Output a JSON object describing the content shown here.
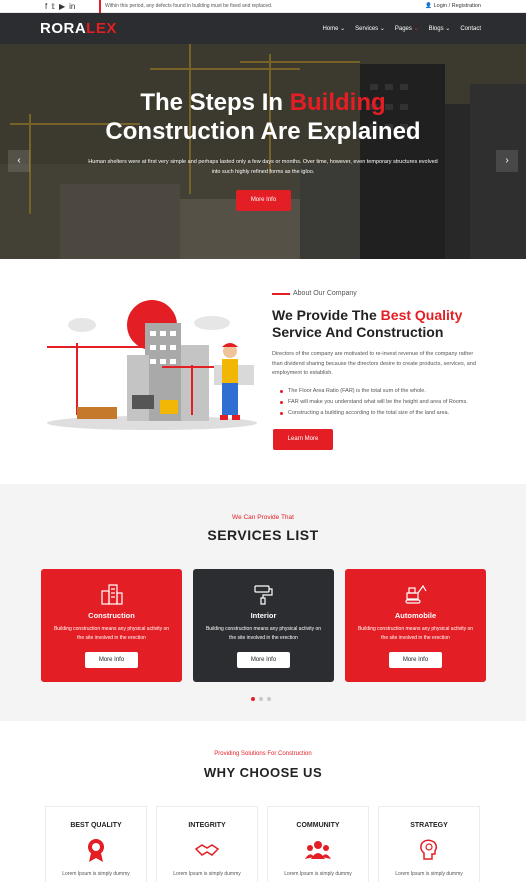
{
  "topbar": {
    "social_icons": [
      "facebook-icon",
      "twitter-icon",
      "youtube-icon",
      "linkedin-icon"
    ],
    "notice": "Within this period, any defects found in building must be fixed and replaced.",
    "login": "Login / Registration"
  },
  "nav": {
    "logo_main": "RORA",
    "logo_accent": "LEX",
    "items": [
      {
        "label": "Home",
        "dropdown": true
      },
      {
        "label": "Services",
        "dropdown": true
      },
      {
        "label": "Pages",
        "dropdown": true
      },
      {
        "label": "Blogs",
        "dropdown": true
      },
      {
        "label": "Contact",
        "dropdown": false
      }
    ]
  },
  "hero": {
    "title_part1": "The Steps In ",
    "title_accent": "Building",
    "title_line2": "Construction Are Explained",
    "subtitle": "Human shelters were at first very simple and perhaps lasted only a few days or months. Over time, however, even temporary structures evolved into such highly refined forms as the igloo.",
    "button": "More Info",
    "prev_arrow": "‹",
    "next_arrow": "›"
  },
  "about": {
    "kicker": "About Our Company",
    "title_part1": "We Provide The ",
    "title_accent": "Best Quality",
    "title_line2": "Service And Construction",
    "text": "Directors of the company are motivated to re-invest revenue of the company rather than dividend sharing because the directors desire to create products, services, and employment to establish.",
    "bullets": [
      "The Floor Area Ratio (FAR) is the total sum of the whole.",
      "FAR will make you understand what will be the height and area of Rooms.",
      "Constructing a building according to the total size of the land area."
    ],
    "button": "Learn More"
  },
  "services": {
    "kicker": "We Can Provide That",
    "title": "SERVICES LIST",
    "cards": [
      {
        "title": "Construction",
        "text": "Building construction means any physical activity on the site involved in the erection",
        "button": "More Info",
        "icon": "buildings-icon"
      },
      {
        "title": "Interior",
        "text": "Building construction means any physical activity on the site involved in the erection",
        "button": "More Info",
        "icon": "paint-roller-icon"
      },
      {
        "title": "Automobile",
        "text": "Building construction means any physical activity on the site involved in the erection",
        "button": "More Info",
        "icon": "excavator-icon"
      }
    ]
  },
  "why": {
    "kicker": "Providing Solutions For Construction",
    "title": "WHY CHOOSE US",
    "cards": [
      {
        "title": "BEST QUALITY",
        "text": "Lorem Ipsum is simply dummy",
        "icon": "award-icon"
      },
      {
        "title": "INTEGRITY",
        "text": "Lorem Ipsum is simply dummy",
        "icon": "handshake-icon"
      },
      {
        "title": "COMMUNITY",
        "text": "Lorem Ipsum is simply dummy",
        "icon": "community-icon"
      },
      {
        "title": "STRATEGY",
        "text": "Lorem Ipsum is simply dummy",
        "icon": "strategy-icon"
      }
    ]
  },
  "colors": {
    "accent": "#e31e24",
    "dark": "#2b2d30"
  }
}
